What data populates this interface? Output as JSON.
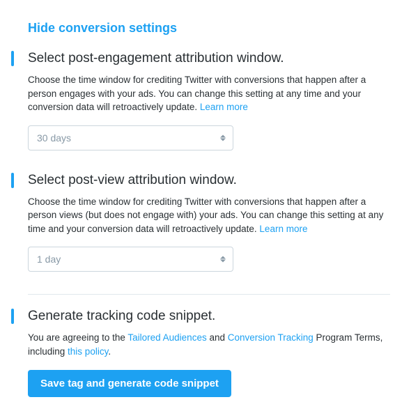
{
  "hide_link": "Hide conversion settings",
  "sections": {
    "post_engagement": {
      "title": "Select post-engagement attribution window.",
      "desc_pre": "Choose the time window for crediting Twitter with conversions that happen after a person engages with your ads. You can change this setting at any time and your conversion data will retroactively update. ",
      "learn_more": "Learn more",
      "select_value": "30 days"
    },
    "post_view": {
      "title": "Select post-view attribution window.",
      "desc_pre": "Choose the time window for crediting Twitter with conversions that happen after a person views (but does not engage with) your ads. You can change this setting at any time and your conversion data will retroactively update. ",
      "learn_more": "Learn more",
      "select_value": "1 day"
    },
    "generate": {
      "title": "Generate tracking code snippet.",
      "agree_pre": "You are agreeing to the ",
      "link1": "Tailored Audiences",
      "mid1": " and ",
      "link2": "Conversion Tracking",
      "mid2": " Program Terms, including ",
      "link3": "this policy",
      "suffix": ".",
      "button": "Save tag and generate code snippet"
    }
  }
}
